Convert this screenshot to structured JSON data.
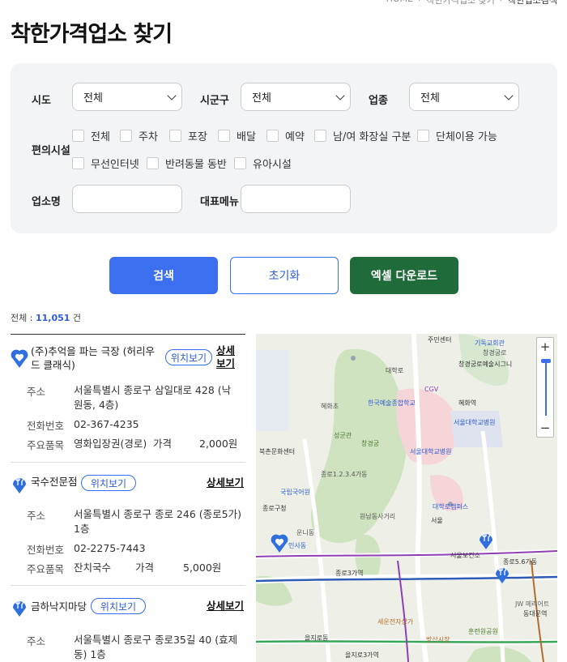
{
  "breadcrumb": [
    "HOME",
    "착한가격업소 찾기",
    "착한업소검색"
  ],
  "page_title": "착한가격업소 찾기",
  "filters": {
    "sido_label": "시도",
    "sido_value": "전체",
    "sigungu_label": "시군구",
    "sigungu_value": "전체",
    "category_label": "업종",
    "category_value": "전체",
    "amenities_label": "편의시설",
    "amenities": [
      "전체",
      "주차",
      "포장",
      "배달",
      "예약",
      "남/여 화장실 구분",
      "단체이용 가능",
      "무선인터넷",
      "반려동물 동반",
      "유아시설"
    ],
    "name_label": "업소명",
    "menu_label": "대표메뉴"
  },
  "buttons": {
    "search": "검색",
    "reset": "초기화",
    "excel": "엑셀 다운로드"
  },
  "total": {
    "label": "전체 :",
    "count": "11,051",
    "unit": "건"
  },
  "list_labels": {
    "locate": "위치보기",
    "detail": "상세보기",
    "address": "주소",
    "phone": "전화번호",
    "item": "주요품목",
    "price": "가격"
  },
  "stores": [
    {
      "name": "(주)추억을 파는 극장 (허리우드 클래식)",
      "address": "서울특별시 종로구 삼일대로 428 (낙원동, 4층)",
      "phone": "02-367-4235",
      "item": "영화입장권(경로)",
      "price": "2,000원",
      "icon": "heart-pin-icon"
    },
    {
      "name": "국수전문점",
      "address": "서울특별시 종로구 종로 246 (종로5가) 1층",
      "phone": "02-2275-7443",
      "item": "잔치국수",
      "price": "5,000원",
      "icon": "restaurant-pin-icon"
    },
    {
      "name": "금하낙지마당",
      "address": "서울특별시 종로구 종로35길 40 (효제동) 1층",
      "icon": "restaurant-pin-icon"
    }
  ],
  "map": {
    "zoom_in": "+",
    "zoom_out": "−",
    "labels": [
      "주민센터",
      "기독교회관",
      "창경궁로",
      "창경궁로예술시그니",
      "대학로",
      "CGV",
      "혜화역",
      "한국예술종합학교",
      "서울대학교병원",
      "혜화초",
      "성균관",
      "창경궁",
      "북촌문화센터",
      "서울대학교병원",
      "국립국어원",
      "대학로캠퍼스",
      "종로구청",
      "서울",
      "종로3가역",
      "종로5.6가동",
      "서울보건소",
      "동대문역",
      "을지로3가역",
      "종로1.2.3.4가동",
      "세운전자상가",
      "을지로동",
      "방산시장",
      "훈련원공원",
      "JW 메리어트",
      "원남동사거리",
      "운니동",
      "인사동"
    ],
    "colors": {
      "park": "#cfe3c0",
      "campus": "#f5d5d8",
      "water": "#bcd9ee",
      "road": "#ffffff",
      "marker": "#2f6fe0"
    }
  }
}
